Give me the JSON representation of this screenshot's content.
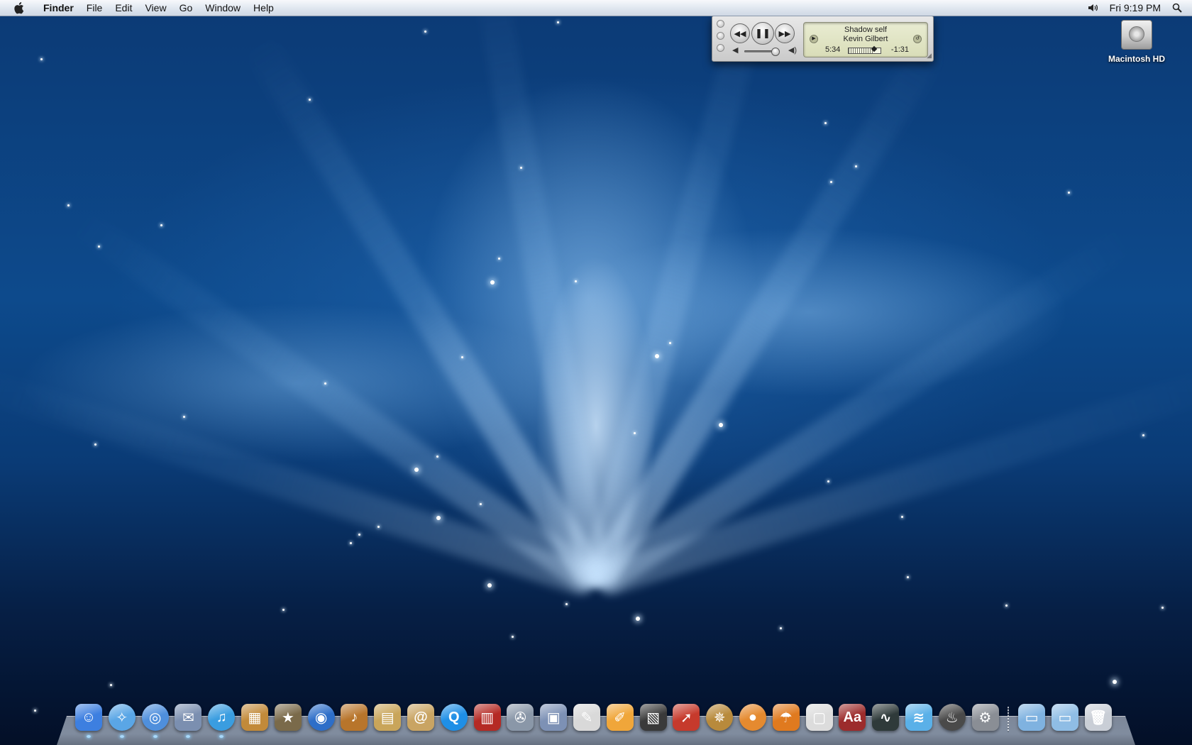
{
  "menubar": {
    "app_name": "Finder",
    "menus": [
      "File",
      "Edit",
      "View",
      "Go",
      "Window",
      "Help"
    ],
    "clock": "Fri 9:19 PM",
    "icons": [
      "apple-icon",
      "speaker-icon",
      "spotlight-icon"
    ]
  },
  "mini_player": {
    "song": "Shadow self",
    "artist": "Kevin Gilbert",
    "elapsed": "5:34",
    "remaining": "-1:31",
    "progress": 0.8,
    "volume": 0.85,
    "state": "playing",
    "buttons": [
      "previous",
      "pause",
      "next"
    ]
  },
  "desktop_icons": [
    {
      "label": "Macintosh HD",
      "icon": "hard-drive-icon"
    }
  ],
  "dock": {
    "apps": [
      {
        "name": "finder",
        "glyph": "☺",
        "color": "#3d7fe0",
        "running": true
      },
      {
        "name": "safari",
        "glyph": "✧",
        "color": "#5aa6e6",
        "running": true,
        "round": true
      },
      {
        "name": "ichat",
        "glyph": "◎",
        "color": "#4f8fdc",
        "running": true,
        "round": true
      },
      {
        "name": "mail",
        "glyph": "✉",
        "color": "#7b8fb0",
        "running": true
      },
      {
        "name": "itunes",
        "glyph": "♫",
        "color": "#3a9de0",
        "running": true,
        "round": true
      },
      {
        "name": "iphoto",
        "glyph": "▦",
        "color": "#c28a3a",
        "running": false
      },
      {
        "name": "imovie",
        "glyph": "★",
        "color": "#7a6a4a",
        "running": false
      },
      {
        "name": "idvd",
        "glyph": "◉",
        "color": "#2d6ec8",
        "running": false,
        "round": true
      },
      {
        "name": "garageband",
        "glyph": "♪",
        "color": "#b8752b",
        "running": false
      },
      {
        "name": "iweb",
        "glyph": "▤",
        "color": "#c9a55a",
        "running": false
      },
      {
        "name": "address-book",
        "glyph": "@",
        "color": "#c9a463",
        "running": false
      },
      {
        "name": "quicktime",
        "glyph": "Q",
        "color": "#1f8fe6",
        "running": false,
        "round": true
      },
      {
        "name": "front-row",
        "glyph": "▥",
        "color": "#b52a24",
        "running": false
      },
      {
        "name": "automator",
        "glyph": "✇",
        "color": "#8a97a8",
        "running": false
      },
      {
        "name": "preview",
        "glyph": "▣",
        "color": "#7d91b5",
        "running": false
      },
      {
        "name": "textedit",
        "glyph": "✎",
        "color": "#d9d9d9",
        "running": false
      },
      {
        "name": "pages",
        "glyph": "✐",
        "color": "#f0a63a",
        "running": false
      },
      {
        "name": "clapper",
        "glyph": "▧",
        "color": "#3a3a3a",
        "running": false
      },
      {
        "name": "transmit",
        "glyph": "➚",
        "color": "#c63a2c",
        "running": false
      },
      {
        "name": "cog",
        "glyph": "✵",
        "color": "#b88a3c",
        "running": false,
        "round": true
      },
      {
        "name": "piggy-bank",
        "glyph": "●",
        "color": "#e58a2f",
        "running": false,
        "round": true
      },
      {
        "name": "umbrella",
        "glyph": "☂",
        "color": "#e07a1f",
        "running": false
      },
      {
        "name": "classic-mac",
        "glyph": "▢",
        "color": "#dcdcdc",
        "running": false
      },
      {
        "name": "dictionary",
        "glyph": "Aa",
        "color": "#9c2c2c",
        "running": false
      },
      {
        "name": "activity-monitor",
        "glyph": "∿",
        "color": "#2f3a3a",
        "running": false
      },
      {
        "name": "fish",
        "glyph": "≋",
        "color": "#5ab0e8",
        "running": false
      },
      {
        "name": "onyx",
        "glyph": "♨",
        "color": "#4a4a4a",
        "running": false,
        "round": true
      },
      {
        "name": "system-preferences",
        "glyph": "⚙",
        "color": "#8a8e95",
        "running": false
      }
    ],
    "right": [
      {
        "name": "applications-folder",
        "glyph": "▭",
        "color": "#7fb2e0"
      },
      {
        "name": "downloads-folder",
        "glyph": "▭",
        "color": "#8fbde5"
      },
      {
        "name": "trash",
        "glyph": "🗑",
        "color": "#c9ced6"
      }
    ]
  }
}
